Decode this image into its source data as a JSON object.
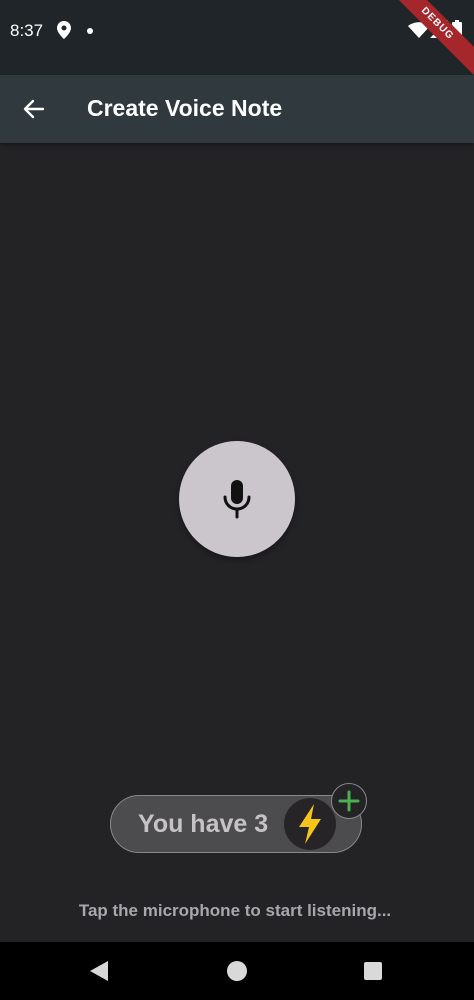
{
  "status_bar": {
    "time": "8:37",
    "debug_label": "DEBUG"
  },
  "app_bar": {
    "title": "Create Voice Note",
    "back_icon": "arrow-back-icon"
  },
  "mic": {
    "icon": "microphone-icon"
  },
  "credits": {
    "text": "You have 3",
    "icon": "lightning-bolt-icon",
    "add_icon": "plus-icon",
    "bolt_color": "#f5c518",
    "add_color": "#4caf50"
  },
  "hint": "Tap the microphone to start listening...",
  "nav_bar": {
    "back_icon": "triangle-back-icon",
    "home_icon": "circle-home-icon",
    "recents_icon": "square-recents-icon"
  },
  "colors": {
    "background": "#232225",
    "app_bar": "#2f393e",
    "mic_button": "#cac6cb"
  }
}
